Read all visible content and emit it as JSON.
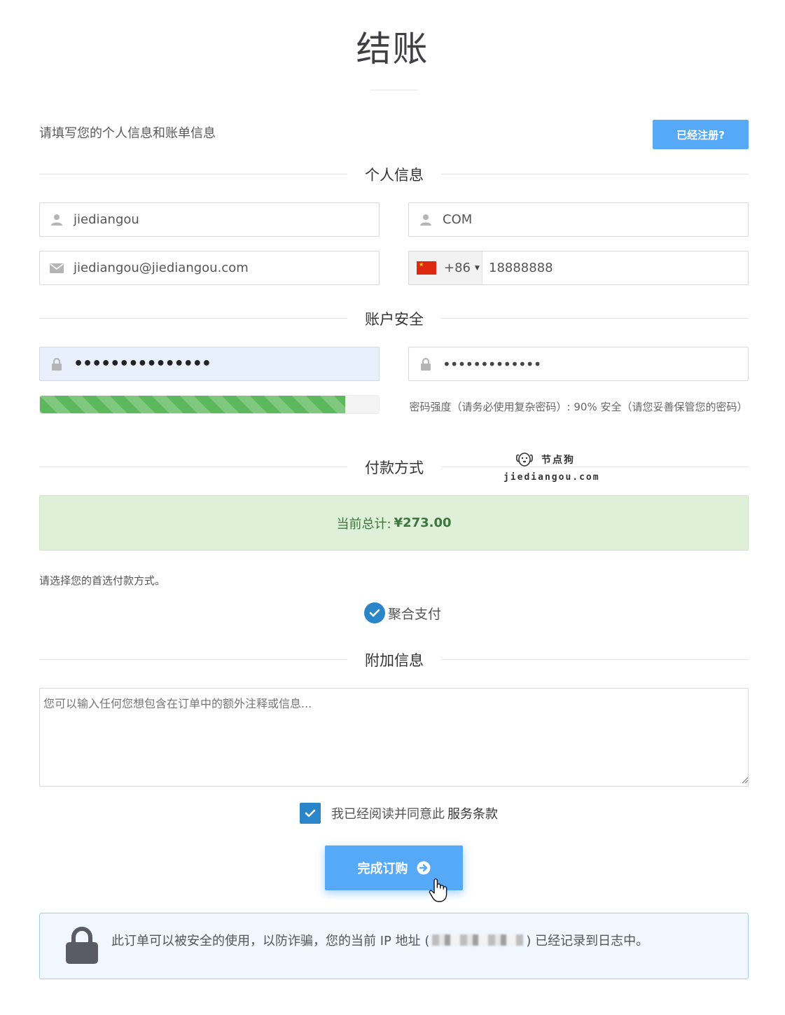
{
  "page": {
    "title": "结账"
  },
  "intro_text": "请填写您的个人信息和账单信息",
  "already_registered_button": "已经注册?",
  "sections": {
    "personal_info": "个人信息",
    "account_security": "账户安全",
    "payment_method": "付款方式",
    "additional_info": "附加信息"
  },
  "personal": {
    "first_name": "jiediangou",
    "last_name": "COM",
    "email": "jiediangou@jiediangou.com",
    "phone_country_code": "+86",
    "phone_number": "18888888",
    "flag_icon": "china-flag-icon"
  },
  "security": {
    "password_mask": "•••••••••••••••",
    "confirm_password_mask": "•••••••••••••",
    "strength_percent": 90,
    "strength_text": "密码强度（请务必使用复杂密码）: 90% 安全（请您妥善保管您的密码）"
  },
  "watermark": {
    "brand": "节点狗",
    "url": "jiediangou.com"
  },
  "payment": {
    "total_label": "当前总计:",
    "total_value": "¥273.00",
    "choose_hint": "请选择您的首选付款方式。",
    "option_label": "聚合支付",
    "option_selected": true
  },
  "notes": {
    "placeholder": "您可以输入任何您想包含在订单中的额外注释或信息..."
  },
  "terms": {
    "text": "我已经阅读并同意此",
    "link": "服务条款",
    "checked": true
  },
  "complete_button": "完成订购",
  "security_notice": {
    "prefix": "此订单可以被安全的使用，以防诈骗，您的当前 IP 地址 (",
    "suffix": ") 已经记录到日志中。"
  },
  "colors": {
    "primary_button": "#56a9f7",
    "check_blue": "#2a85c9",
    "success_bg": "#dff0d8",
    "success_text": "#3c763d",
    "strength_bar": "#5cb85c",
    "autofill_bg": "#e8f0fe"
  }
}
